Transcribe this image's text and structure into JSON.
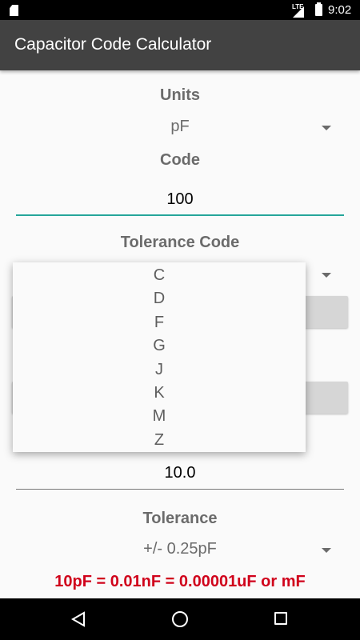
{
  "status_bar": {
    "network": "LTE",
    "time": "9:02"
  },
  "app_bar": {
    "title": "Capacitor Code Calculator"
  },
  "units": {
    "label": "Units",
    "selected": "pF"
  },
  "code": {
    "label": "Code",
    "value": "100"
  },
  "tolerance_code": {
    "label": "Tolerance Code",
    "options": [
      "C",
      "D",
      "F",
      "G",
      "J",
      "K",
      "M",
      "Z"
    ]
  },
  "value_field": {
    "value": "10.0"
  },
  "tolerance": {
    "label": "Tolerance",
    "selected": "+/- 0.25pF"
  },
  "result": {
    "text": "10pF = 0.01nF = 0.00001uF or mF",
    "color": "#d0021b"
  },
  "colors": {
    "accent": "#26a69a",
    "app_bar": "#424242"
  },
  "nav": {
    "back": "back-icon",
    "home": "home-icon",
    "recents": "recents-icon"
  }
}
